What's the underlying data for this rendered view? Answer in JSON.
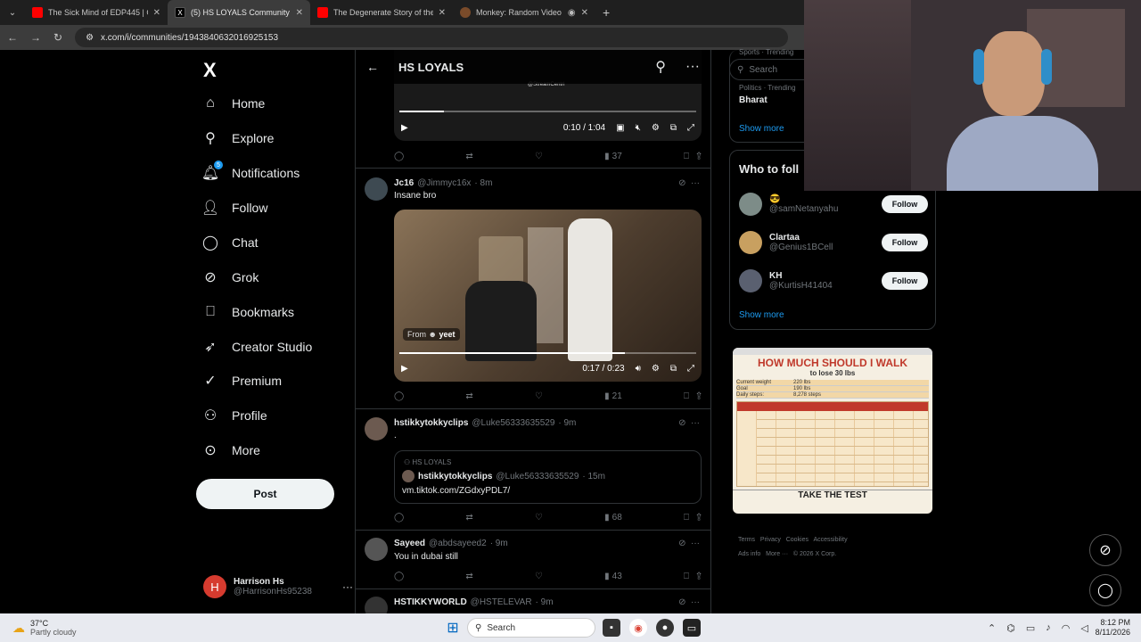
{
  "browser": {
    "tabs": [
      {
        "title": "The Sick Mind of EDP445 | Offic",
        "type": "youtube"
      },
      {
        "title": "(5) HS LOYALS Community / X",
        "type": "x",
        "active": true
      },
      {
        "title": "The Degenerate Story of the U",
        "type": "youtube"
      },
      {
        "title": "Monkey: Random Video Ch",
        "type": "monkey"
      }
    ],
    "url": "x.com/i/communities/1943840632016925153"
  },
  "nav": {
    "logo": "X",
    "items": [
      {
        "label": "Home",
        "icon": "home-icon"
      },
      {
        "label": "Explore",
        "icon": "search-icon"
      },
      {
        "label": "Notifications",
        "icon": "bell-icon",
        "badge": "5"
      },
      {
        "label": "Follow",
        "icon": "add-person-icon"
      },
      {
        "label": "Chat",
        "icon": "chat-icon"
      },
      {
        "label": "Grok",
        "icon": "grok-icon"
      },
      {
        "label": "Bookmarks",
        "icon": "bookmark-icon"
      },
      {
        "label": "Creator Studio",
        "icon": "rocket-icon"
      },
      {
        "label": "Premium",
        "icon": "premium-icon"
      },
      {
        "label": "Profile",
        "icon": "person-icon"
      },
      {
        "label": "More",
        "icon": "more-circle-icon"
      }
    ],
    "post_label": "Post",
    "account": {
      "initial": "H",
      "name": "Harrison Hs",
      "handle": "@HarrisonHs95238"
    }
  },
  "feed": {
    "title": "HS LOYALS",
    "video1": {
      "watermark": "@StreamCentrl",
      "time": "0:10 / 1:04",
      "progress": 0.15,
      "views": "37"
    },
    "tweet1": {
      "name": "Jc16",
      "handle": "@Jimmyc16x",
      "time": "· 8m",
      "text": "Insane bro",
      "from_label": "From",
      "from_name": "yeet",
      "time_video": "0:17 / 0:23",
      "progress": 0.76,
      "views": "21"
    },
    "tweet2": {
      "name": "hstikkytokkyclips",
      "handle": "@Luke56333635529",
      "time": "· 9m",
      "text": ".",
      "quote_community": "HS LOYALS",
      "quote_name": "hstikkytokkyclips",
      "quote_handle": "@Luke56333635529",
      "quote_time": "· 15m",
      "quote_text": "vm.tiktok.com/ZGdxyPDL7/",
      "views": "68"
    },
    "tweet3": {
      "name": "Sayeed",
      "handle": "@abdsayeed2",
      "time": "· 9m",
      "text": "You in dubai still",
      "views": "43"
    },
    "tweet4": {
      "name": "HSTIKKYWORLD",
      "handle": "@HSTELEVAR",
      "time": "· 9m"
    }
  },
  "sidebar": {
    "search_placeholder": "Search",
    "trend_label1": "Sports · Trending",
    "trend_label2": "Politics · Trending",
    "trend_name": "Bharat",
    "show_more": "Show more",
    "who_title": "Who to foll",
    "follow_suggestions": [
      {
        "name": "😎",
        "handle": "@samNetanyahu"
      },
      {
        "name": "Clartaa",
        "handle": "@Genius1BCell"
      },
      {
        "name": "KH",
        "handle": "@KurtisH41404"
      }
    ],
    "follow_label": "Follow",
    "show_more2": "Show more",
    "ad": {
      "title": "HOW MUCH SHOULD I WALK",
      "subtitle": "to lose 30 lbs",
      "rows": [
        {
          "label": "Current weight",
          "value": "220 lbs"
        },
        {
          "label": "Goal",
          "value": "190 lbs"
        },
        {
          "label": "Daily steps:",
          "value": "8,278 steps"
        }
      ],
      "cta": "TAKE THE TEST"
    },
    "footer": [
      "Terms",
      "Privacy",
      "Cookies",
      "Accessibility",
      "Ads info",
      "More ···",
      "© 2026 X Corp."
    ]
  },
  "taskbar": {
    "weather_temp": "37°C",
    "weather_text": "Partly cloudy",
    "search": "Search",
    "time": "8:12 PM",
    "date": "8/11/2026"
  }
}
